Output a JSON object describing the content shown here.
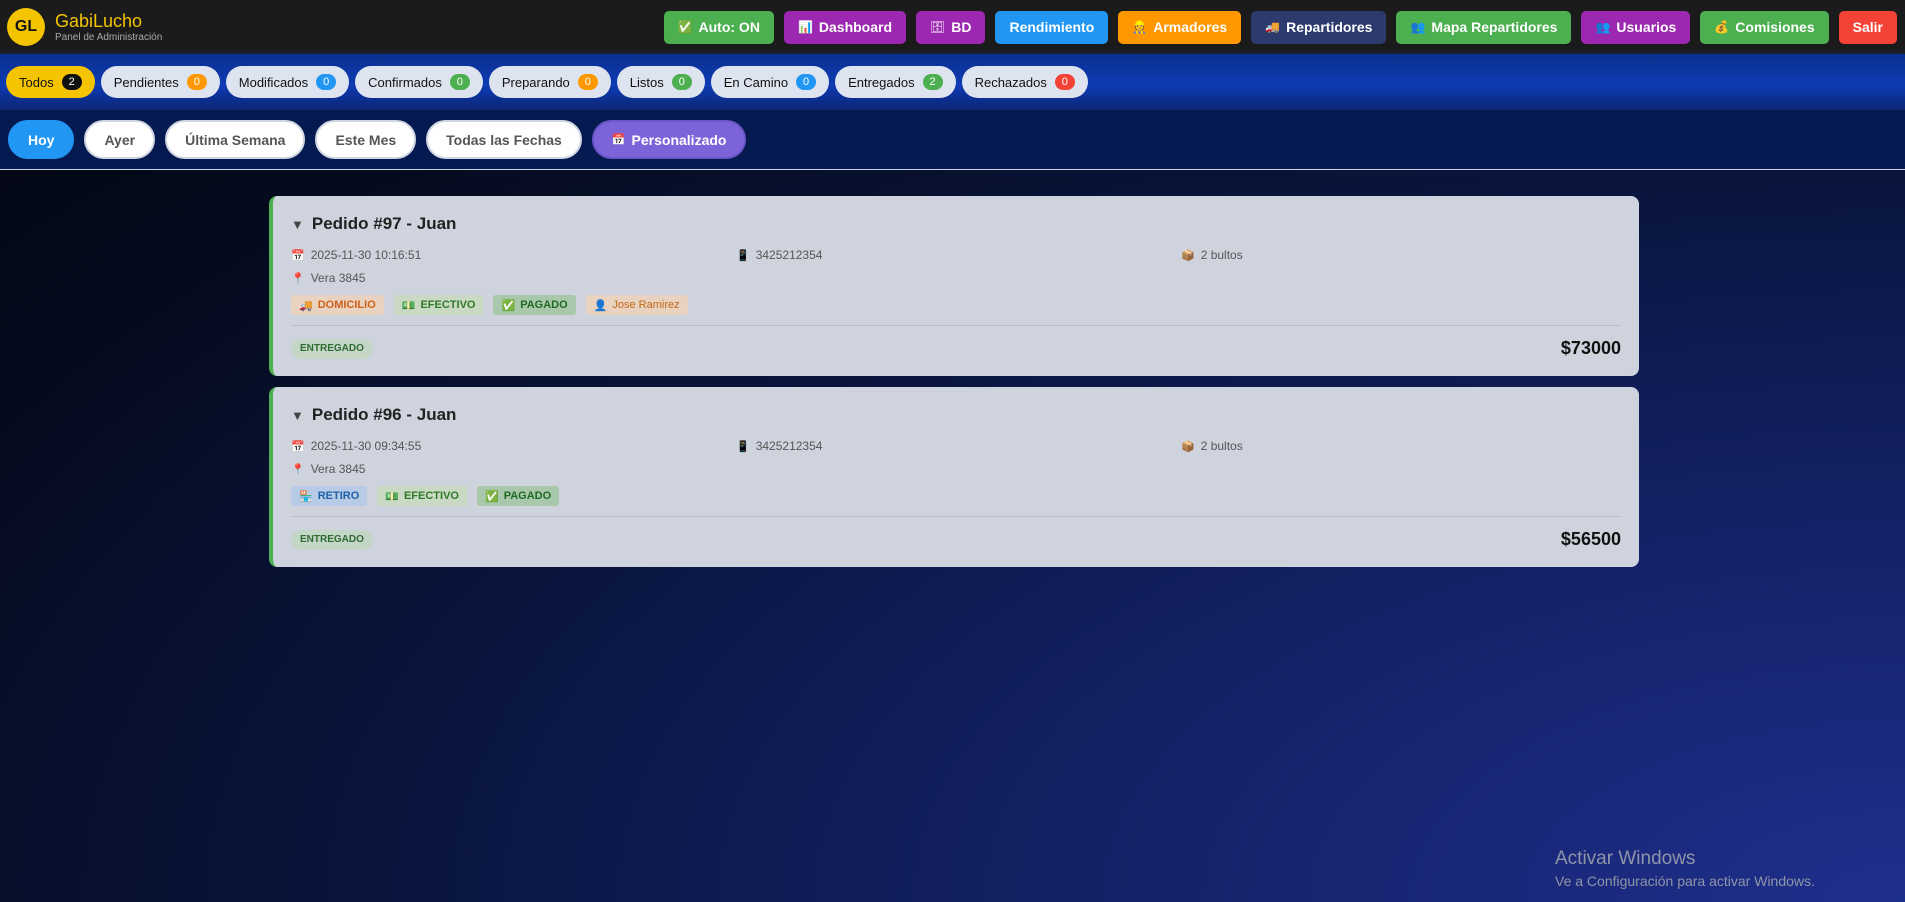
{
  "brand": {
    "initials": "GL",
    "name": "GabiLucho",
    "subtitle": "Panel de Administración"
  },
  "nav": [
    {
      "label": "Auto: ON",
      "icon": "✅",
      "color": "#4caf50"
    },
    {
      "label": "Dashboard",
      "icon": "📊",
      "color": "#9c27b0"
    },
    {
      "label": "BD",
      "icon": "🗄",
      "color": "#9c27b0"
    },
    {
      "label": "Rendimiento",
      "icon": "",
      "color": "#2196f3"
    },
    {
      "label": "Armadores",
      "icon": "👷",
      "color": "#ff9800"
    },
    {
      "label": "Repartidores",
      "icon": "🚚",
      "color": "#2c3a6e"
    },
    {
      "label": "Mapa Repartidores",
      "icon": "👥",
      "color": "#4caf50"
    },
    {
      "label": "Usuarios",
      "icon": "👥",
      "color": "#9c27b0"
    },
    {
      "label": "Comisiones",
      "icon": "💰",
      "color": "#4caf50"
    },
    {
      "label": "Salir",
      "icon": "",
      "color": "#f44336"
    }
  ],
  "status_filters": [
    {
      "label": "Todos",
      "count": "2",
      "badge_color": "#111111"
    },
    {
      "label": "Pendientes",
      "count": "0",
      "badge_color": "#ff9800"
    },
    {
      "label": "Modificados",
      "count": "0",
      "badge_color": "#2196f3"
    },
    {
      "label": "Confirmados",
      "count": "0",
      "badge_color": "#4caf50"
    },
    {
      "label": "Preparando",
      "count": "0",
      "badge_color": "#ff9800"
    },
    {
      "label": "Listos",
      "count": "0",
      "badge_color": "#4caf50"
    },
    {
      "label": "En Camino",
      "count": "0",
      "badge_color": "#2196f3"
    },
    {
      "label": "Entregados",
      "count": "2",
      "badge_color": "#4caf50"
    },
    {
      "label": "Rechazados",
      "count": "0",
      "badge_color": "#f44336"
    }
  ],
  "date_filters": [
    "Hoy",
    "Ayer",
    "Última Semana",
    "Este Mes",
    "Todas las Fechas",
    "Personalizado"
  ],
  "orders": [
    {
      "title": "Pedido #97 - Juan",
      "datetime": "2025-11-30 10:16:51",
      "phone": "3425212354",
      "packages": "2 bultos",
      "address": "Vera 3845",
      "delivery": "DOMICILIO",
      "payment": "EFECTIVO",
      "paid": "PAGADO",
      "courier": "Jose Ramirez",
      "status": "ENTREGADO",
      "total": "$73000"
    },
    {
      "title": "Pedido #96 - Juan",
      "datetime": "2025-11-30 09:34:55",
      "phone": "3425212354",
      "packages": "2 bultos",
      "address": "Vera 3845",
      "delivery": "RETIRO",
      "payment": "EFECTIVO",
      "paid": "PAGADO",
      "courier": "",
      "status": "ENTREGADO",
      "total": "$56500"
    }
  ],
  "watermark": {
    "line1": "Activar Windows",
    "line2": "Ve a Configuración para activar Windows."
  }
}
